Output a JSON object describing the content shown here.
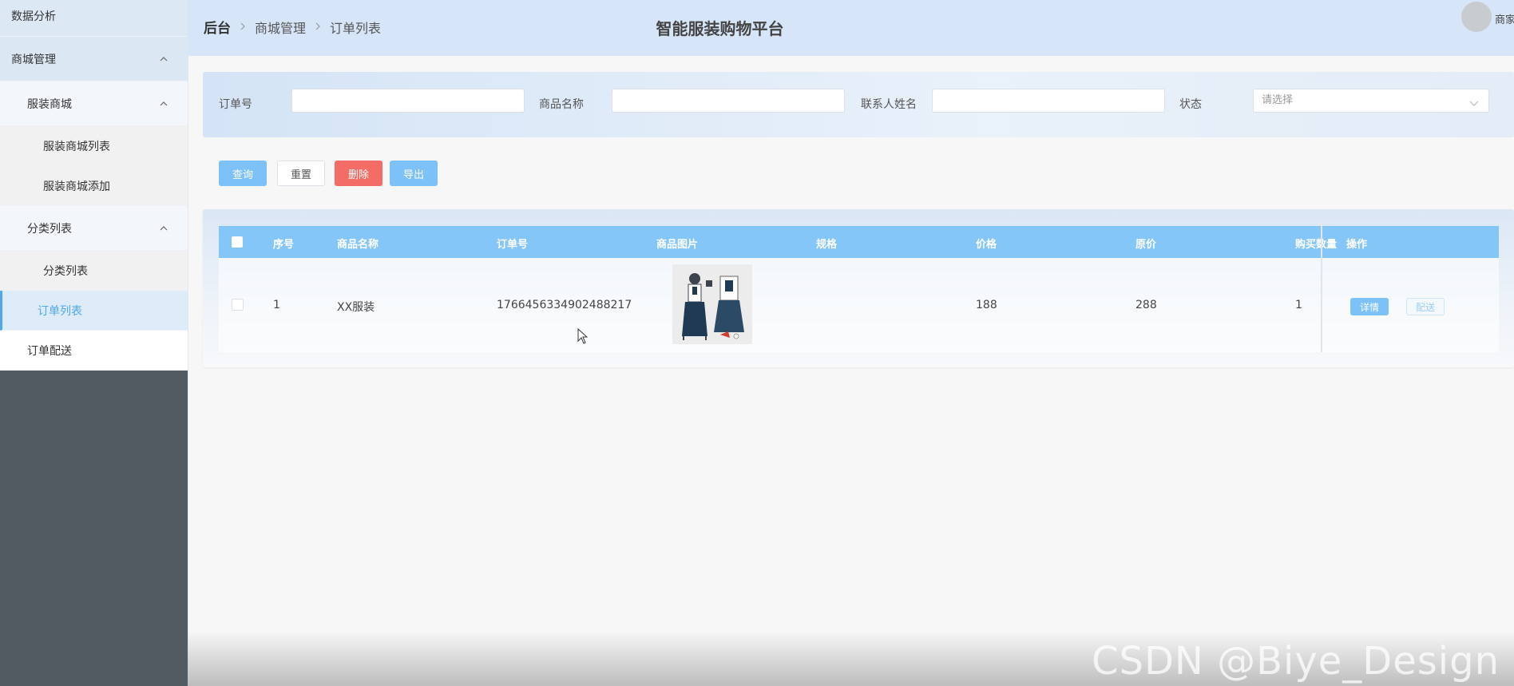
{
  "sidebar": {
    "items": [
      {
        "label": "数据分析"
      },
      {
        "label": "商城管理"
      },
      {
        "label": "服装商城"
      },
      {
        "label": "服装商城列表"
      },
      {
        "label": "服装商城添加"
      },
      {
        "label": "分类列表"
      },
      {
        "label": "分类列表"
      },
      {
        "label": "订单列表"
      },
      {
        "label": "订单配送"
      }
    ],
    "icons": {
      "expanded": "chevron-up-icon"
    }
  },
  "header": {
    "breadcrumb": [
      "后台",
      "商城管理",
      "订单列表"
    ],
    "title": "智能服装购物平台",
    "user_name": "商家"
  },
  "search": {
    "order_no_label": "订单号",
    "order_no_value": "",
    "product_name_label": "商品名称",
    "product_name_value": "",
    "contact_label": "联系人姓名",
    "contact_value": "",
    "status_label": "状态",
    "status_placeholder": "请选择"
  },
  "actions": {
    "query": "查询",
    "reset": "重置",
    "delete": "删除",
    "export": "导出"
  },
  "table": {
    "columns": [
      "序号",
      "商品名称",
      "订单号",
      "商品图片",
      "规格",
      "价格",
      "原价",
      "购买数量",
      "操作"
    ],
    "rows": [
      {
        "index": "1",
        "product_name": "XX服装",
        "order_no": "1766456334902488217",
        "spec": "",
        "price": "188",
        "original_price": "288",
        "quantity": "1"
      }
    ],
    "row_actions": {
      "detail": "详情",
      "deliver": "配送"
    }
  },
  "watermark": "CSDN @Biye_Design",
  "colors": {
    "primary": "#7cc2f8",
    "header_bg": "#d6e5f7",
    "table_header": "#85c6f8",
    "danger": "#f46c66",
    "sidebar_dark": "#525a62",
    "active": "#4ea8f0"
  }
}
